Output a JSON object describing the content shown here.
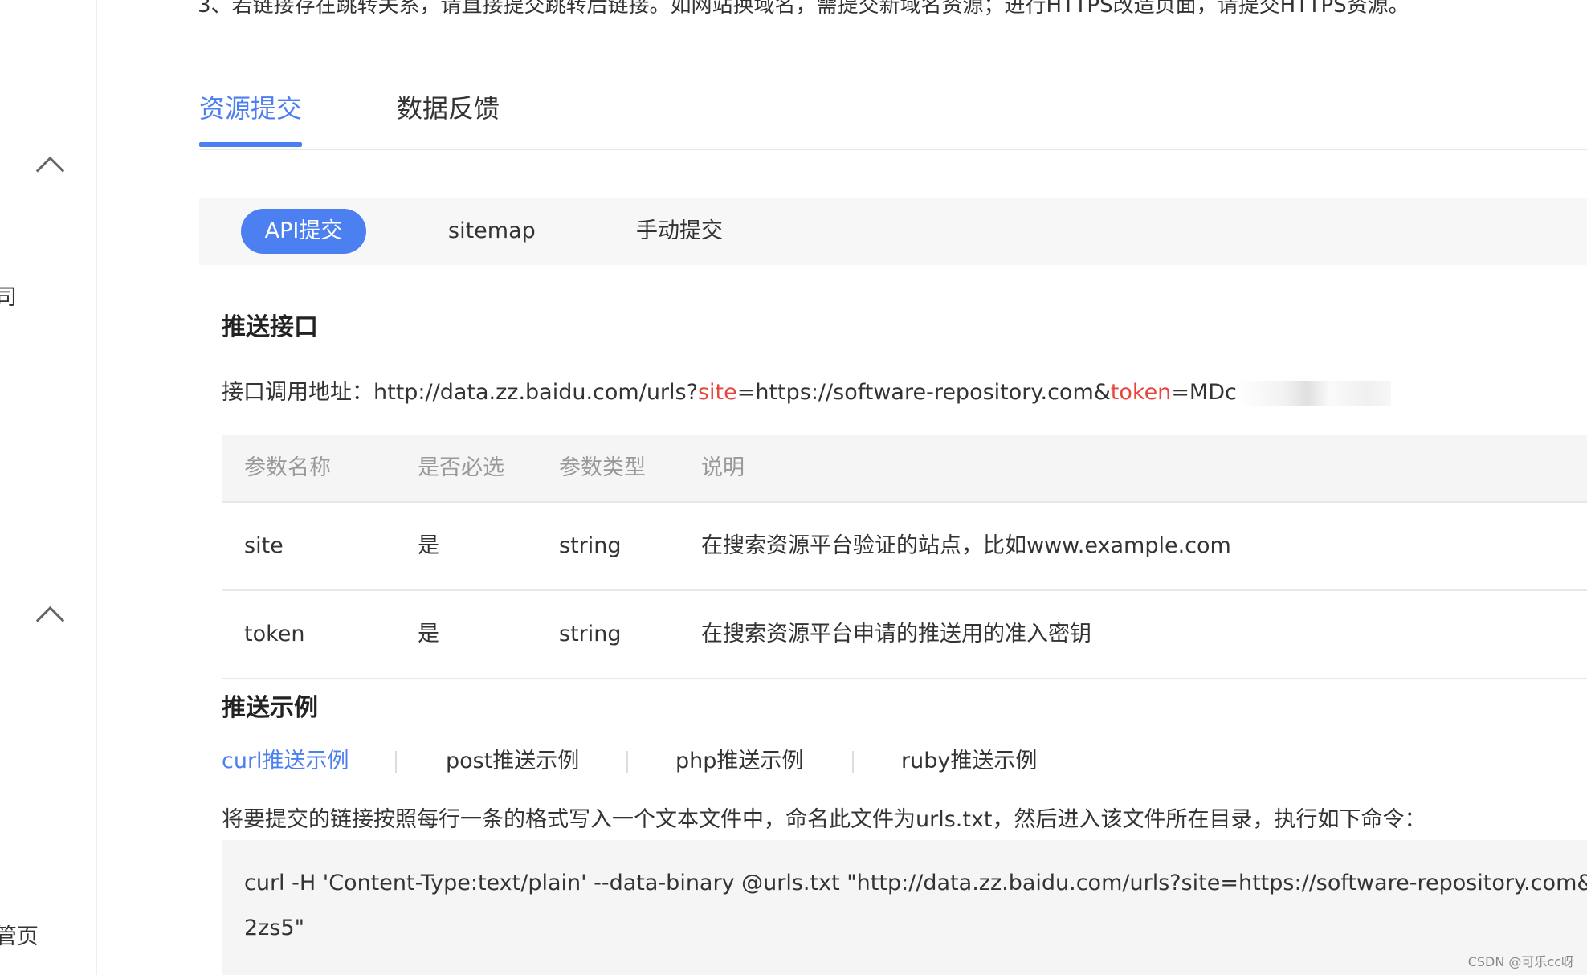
{
  "notice": "3、若链接存在跳转关系，请直接提交跳转后链接。如网站换域名，需提交新域名资源；进行HTTPS改造页面，请提交HTTPS资源。",
  "sidebar": {
    "partial_item_1": "司",
    "partial_item_2": "管页"
  },
  "main_tabs": [
    {
      "label": "资源提交",
      "active": true
    },
    {
      "label": "数据反馈",
      "active": false
    }
  ],
  "sub_tabs": [
    {
      "label": "API提交",
      "active": true
    },
    {
      "label": "sitemap",
      "active": false
    },
    {
      "label": "手动提交",
      "active": false
    }
  ],
  "push_api": {
    "title": "推送接口",
    "url_label": "接口调用地址：",
    "url_base": "http://data.zz.baidu.com/urls?",
    "param_site": "site",
    "site_value": "=https://software-repository.com&",
    "param_token": "token",
    "token_value": "=MDc"
  },
  "param_table": {
    "headers": [
      "参数名称",
      "是否必选",
      "参数类型",
      "说明"
    ],
    "rows": [
      [
        "site",
        "是",
        "string",
        "在搜索资源平台验证的站点，比如www.example.com"
      ],
      [
        "token",
        "是",
        "string",
        "在搜索资源平台申请的推送用的准入密钥"
      ]
    ]
  },
  "examples": {
    "title": "推送示例",
    "tabs": [
      {
        "label": "curl推送示例",
        "active": true
      },
      {
        "label": "post推送示例",
        "active": false
      },
      {
        "label": "php推送示例",
        "active": false
      },
      {
        "label": "ruby推送示例",
        "active": false
      }
    ],
    "instruction": "将要提交的链接按照每行一条的格式写入一个文本文件中，命名此文件为urls.txt，然后进入该文件所在目录，执行如下命令：",
    "code_line_1": "curl -H 'Content-Type:text/plain' --data-binary @urls.txt \"http://data.zz.baidu.com/urls?site=https://software-repository.com&token=MD",
    "code_line_2": "2zs5\""
  },
  "watermark": "CSDN @可乐cc呀",
  "colors": {
    "accent": "#4c7ff0",
    "param_red": "#e8453c",
    "table_header_bg": "#f5f5f5"
  }
}
